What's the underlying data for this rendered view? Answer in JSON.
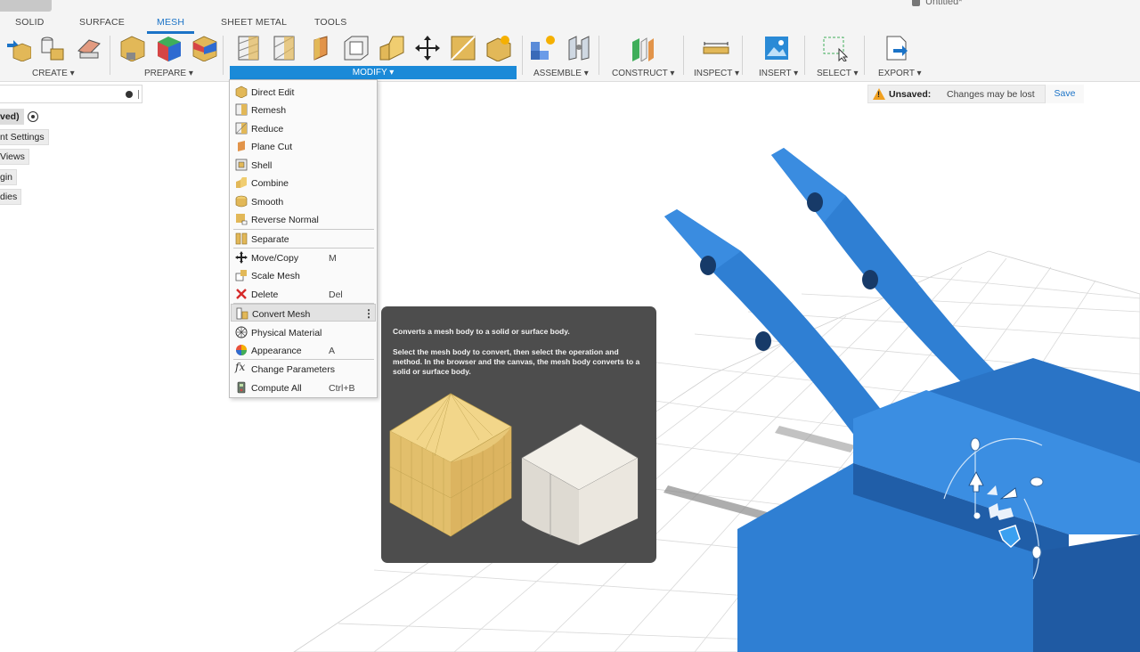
{
  "document": {
    "title": "Untitled*"
  },
  "tabs": [
    {
      "label": "SOLID",
      "active": false
    },
    {
      "label": "SURFACE",
      "active": false
    },
    {
      "label": "MESH",
      "active": true
    },
    {
      "label": "SHEET METAL",
      "active": false
    },
    {
      "label": "TOOLS",
      "active": false
    }
  ],
  "toolbar_groups": [
    {
      "label": "CREATE ▾"
    },
    {
      "label": "PREPARE ▾"
    },
    {
      "label": "MODIFY ▾",
      "active": true
    },
    {
      "label": "ASSEMBLE ▾"
    },
    {
      "label": "CONSTRUCT ▾"
    },
    {
      "label": "INSPECT ▾"
    },
    {
      "label": "INSERT ▾"
    },
    {
      "label": "SELECT ▾"
    },
    {
      "label": "EXPORT ▾"
    }
  ],
  "browser": {
    "nodes": [
      {
        "label": "ved)"
      },
      {
        "label": "nt Settings"
      },
      {
        "label": "Views"
      },
      {
        "label": "gin"
      },
      {
        "label": "dies"
      }
    ]
  },
  "unsaved": {
    "label": "Unsaved:",
    "message": "Changes may be lost",
    "save": "Save"
  },
  "modify_menu": {
    "items": [
      {
        "label": "Direct Edit",
        "shortcut": "",
        "icon": "direct-edit-icon"
      },
      {
        "label": "Remesh",
        "shortcut": "",
        "icon": "remesh-icon"
      },
      {
        "label": "Reduce",
        "shortcut": "",
        "icon": "reduce-icon"
      },
      {
        "label": "Plane Cut",
        "shortcut": "",
        "icon": "plane-cut-icon"
      },
      {
        "label": "Shell",
        "shortcut": "",
        "icon": "shell-icon"
      },
      {
        "label": "Combine",
        "shortcut": "",
        "icon": "combine-icon"
      },
      {
        "label": "Smooth",
        "shortcut": "",
        "icon": "smooth-icon"
      },
      {
        "label": "Reverse Normal",
        "shortcut": "",
        "icon": "reverse-normal-icon"
      },
      {
        "label": "Separate",
        "shortcut": "",
        "icon": "separate-icon"
      },
      {
        "label": "Move/Copy",
        "shortcut": "M",
        "icon": "move-copy-icon"
      },
      {
        "label": "Scale Mesh",
        "shortcut": "",
        "icon": "scale-mesh-icon"
      },
      {
        "label": "Delete",
        "shortcut": "Del",
        "icon": "delete-icon"
      },
      {
        "label": "Convert Mesh",
        "shortcut": "",
        "icon": "convert-mesh-icon",
        "highlighted": true
      },
      {
        "label": "Physical Material",
        "shortcut": "",
        "icon": "physical-material-icon"
      },
      {
        "label": "Appearance",
        "shortcut": "A",
        "icon": "appearance-icon"
      },
      {
        "label": "Change Parameters",
        "shortcut": "",
        "icon": "change-parameters-icon"
      },
      {
        "label": "Compute All",
        "shortcut": "Ctrl+B",
        "icon": "compute-all-icon"
      }
    ]
  },
  "tooltip": {
    "summary": "Converts a mesh body to a solid or surface body.",
    "detail": "Select the mesh body to convert, then select the operation and method. In the browser and the canvas, the mesh body converts to a solid or surface body."
  },
  "colors": {
    "accent": "#1b73c7",
    "modify_bar": "#1b8ad8",
    "model_blue": "#2f7fd3",
    "tooltip_bg": "#4d4d4d",
    "mesh_yellow": "#e8c878",
    "solid_gray": "#e6e2da"
  }
}
